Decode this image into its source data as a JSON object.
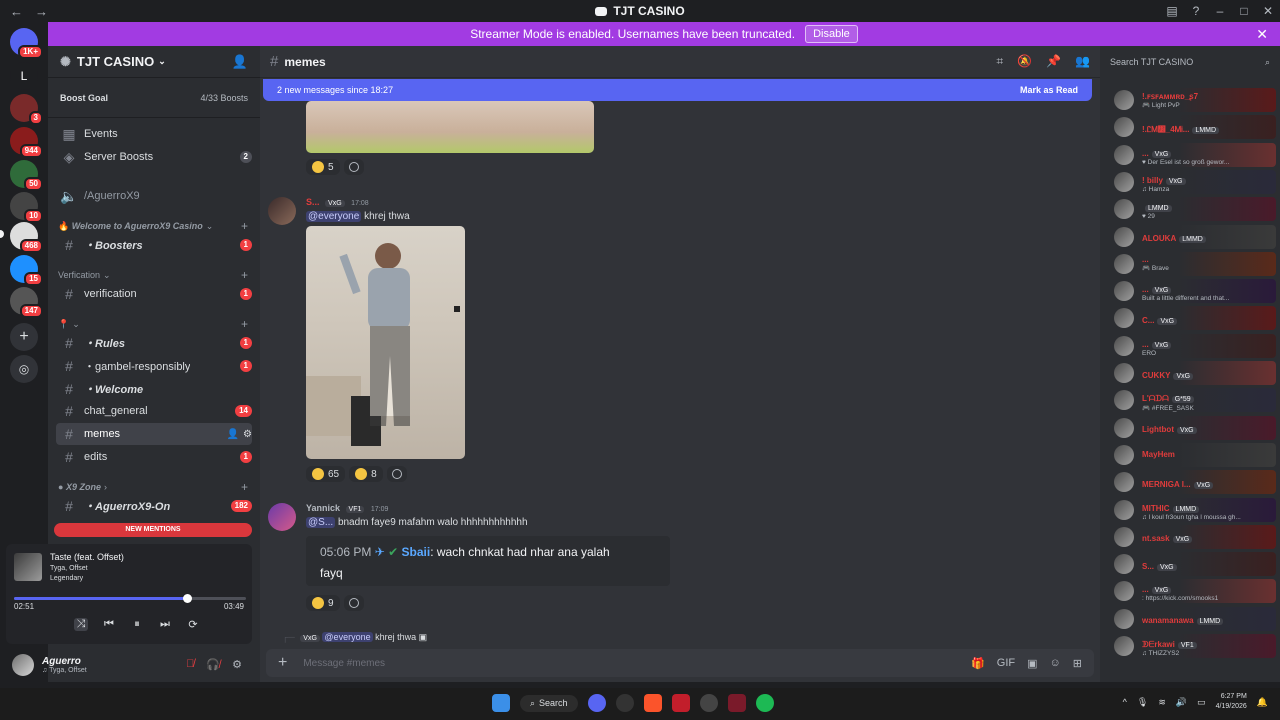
{
  "window": {
    "title": "TJT CASINO"
  },
  "banner": {
    "text": "Streamer Mode is enabled. Usernames have been truncated.",
    "button": "Disable"
  },
  "rail": {
    "badges": [
      "1K+",
      "3",
      "944",
      "50",
      "10",
      "468",
      "15",
      "147"
    ]
  },
  "server": {
    "name": "TJT CASINO",
    "boost_goal_label": "Boost Goal",
    "boost_count": "4/33 Boosts"
  },
  "sidebar": {
    "events": "Events",
    "server_boosts": "Server Boosts",
    "server_boosts_count": "2",
    "voice_channel": "/AguerroX9",
    "category_welcome": "Welcome to AguerroX9 Casino",
    "boosters": "・Boosters",
    "boosters_count": "1",
    "category_verification": "Verfication",
    "verification": "verification",
    "verification_count": "1",
    "category_pin": "",
    "rules": "・Rules",
    "rules_count": "1",
    "gambel": "・gambel-responsibly",
    "gambel_count": "1",
    "welcome": "・Welcome",
    "chat_general": "chat_general",
    "chat_general_count": "14",
    "memes": "memes",
    "edits": "edits",
    "edits_count": "1",
    "category_x9": "X9 Zone",
    "aguerro_on": "・AguerroX9-On",
    "aguerro_on_count": "182",
    "new_mentions": "NEW MENTIONS"
  },
  "player": {
    "song": "Taste (feat. Offset)",
    "artist": "Tyga, Offset",
    "album": "Legendary",
    "elapsed": "02:51",
    "duration": "03:49",
    "progress": 0.746
  },
  "user": {
    "name": "Aguerro",
    "status": "♫ Tyga, Offset"
  },
  "chat": {
    "channel": "memes",
    "new_messages": "2 new messages since 18:27",
    "mark_as_read": "Mark as Read",
    "composer_placeholder": "Message #memes"
  },
  "messages": [
    {
      "reactions": [
        {
          "count": "5"
        }
      ]
    },
    {
      "author": "S...",
      "tag": "VxG",
      "time": "17:08",
      "mention": "@everyone",
      "text": "khrej thwa",
      "reactions": [
        {
          "count": "65"
        },
        {
          "count": "8"
        }
      ]
    },
    {
      "author": "Yannick",
      "tag": "VF1",
      "time": "17:09",
      "mention": "@S...",
      "text": "bnadm faye9 mafahm walo hhhhhhhhhhhh",
      "quote_time": "05:06 PM",
      "quote_author": "Sbaii",
      "quote_text": ": wach chnkat had nhar ana yalah",
      "quote_text2": "fayq",
      "reactions": [
        {
          "count": "9"
        }
      ]
    },
    {
      "tag": "VxG",
      "mention": "@everyone",
      "text": "khrej thwa"
    }
  ],
  "members": {
    "search_placeholder": "Search TJT CASINO",
    "list": [
      {
        "name": "!.ꜰꜱꜰᴀᴍᴍʀᴅ_ʂ7",
        "status": "🎮 Light PvP",
        "color": "#e03c3c"
      },
      {
        "name": "!.ᏝᎷ᏶_4ᎷᎥ...",
        "tag": "LMMD",
        "status": "",
        "color": "#e03c3c"
      },
      {
        "name": "...",
        "tag": "VxG",
        "status": "♥ Der Esel ist so groß gewor...",
        "color": "#e03c3c"
      },
      {
        "name": "! billy",
        "tag": "VxG",
        "status": "♫ Hamza",
        "color": "#e03c3c"
      },
      {
        "name": "",
        "tag": "LMMD",
        "status": "♥ 29",
        "color": "#e03c3c"
      },
      {
        "name": "ALOUKA",
        "tag": "LMMD",
        "status": "",
        "color": "#e03c3c"
      },
      {
        "name": "...",
        "status": "🎮 Brave",
        "color": "#e03c3c"
      },
      {
        "name": "...",
        "tag": "VxG",
        "status": "Built a little different and that...",
        "color": "#e03c3c"
      },
      {
        "name": "C...",
        "tag": "VxG",
        "status": "",
        "color": "#e03c3c"
      },
      {
        "name": "...",
        "tag": "VxG",
        "status": "ERO",
        "color": "#e03c3c"
      },
      {
        "name": "CUKKY",
        "tag": "VxG",
        "status": "",
        "color": "#e03c3c"
      },
      {
        "name": "L'ᗩᗪᗩ",
        "tag": "G*59",
        "status": "🎮 #FREE_SASK",
        "color": "#e03c3c"
      },
      {
        "name": "Lightbot",
        "tag": "VxG",
        "status": "",
        "color": "#e03c3c"
      },
      {
        "name": "MayHem",
        "status": "",
        "color": "#e03c3c"
      },
      {
        "name": "MERNIGA I...",
        "tag": "VxG",
        "status": "",
        "color": "#e03c3c"
      },
      {
        "name": "MITHIC",
        "tag": "LMMD",
        "status": "♫ l koul fr3oun tgha l moussa gh...",
        "color": "#e03c3c"
      },
      {
        "name": "nt.sask",
        "tag": "VxG",
        "status": "",
        "color": "#e03c3c"
      },
      {
        "name": "S...",
        "tag": "VxG",
        "status": "",
        "color": "#e03c3c"
      },
      {
        "name": "...",
        "tag": "VxG",
        "status": ": https://kick.com/smooks1",
        "color": "#e03c3c"
      },
      {
        "name": "wanamanawa",
        "tag": "LMMD",
        "status": "",
        "color": "#e03c3c"
      },
      {
        "name": "ᗫᗴrkawi",
        "tag": "VF1",
        "status": "♫ THIZZYS2",
        "color": "#e03c3c"
      }
    ]
  },
  "taskbar": {
    "search": "Search",
    "time": "6:27 PM",
    "date": "4/19/2026"
  }
}
